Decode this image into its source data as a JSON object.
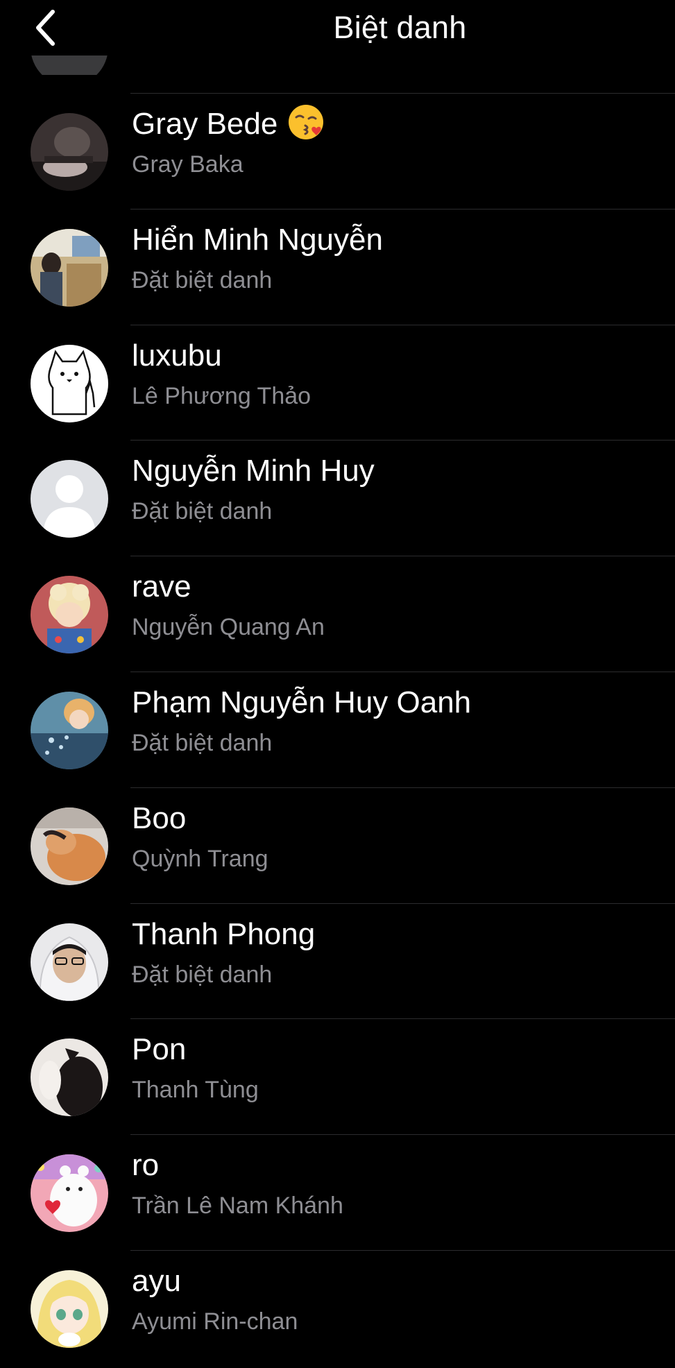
{
  "header": {
    "title": "Biệt danh",
    "back_icon": "chevron-left-icon"
  },
  "colors": {
    "background": "#000000",
    "primary_text": "#ffffff",
    "secondary_text": "#8e8e93",
    "divider": "#2c2c2e"
  },
  "contacts": [
    {
      "name": "Gray Bede",
      "nickname": "Gray Baka",
      "emoji": "kissing-face-emoji"
    },
    {
      "name": "Hiển Minh Nguyễn",
      "nickname": "Đặt biệt danh"
    },
    {
      "name": "luxubu",
      "nickname": "Lê Phương Thảo"
    },
    {
      "name": "Nguyễn Minh Huy",
      "nickname": "Đặt biệt danh"
    },
    {
      "name": "rave",
      "nickname": "Nguyễn Quang An"
    },
    {
      "name": "Phạm Nguyễn Huy Oanh",
      "nickname": "Đặt biệt danh"
    },
    {
      "name": "Boo",
      "nickname": "Quỳnh Trang"
    },
    {
      "name": "Thanh Phong",
      "nickname": "Đặt biệt danh"
    },
    {
      "name": "Pon",
      "nickname": "Thanh Tùng"
    },
    {
      "name": "ro",
      "nickname": "Trần Lê Nam Khánh"
    },
    {
      "name": "ayu",
      "nickname": "Ayumi Rin-chan"
    }
  ]
}
